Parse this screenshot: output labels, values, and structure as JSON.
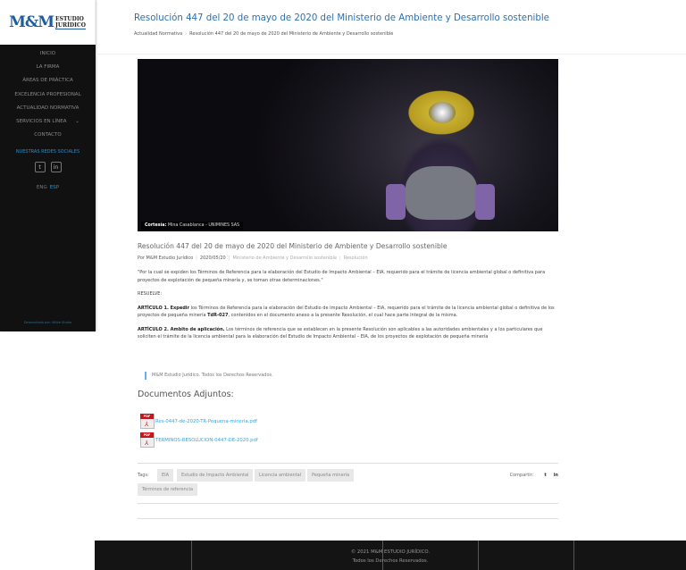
{
  "logo": {
    "mark": "M&M",
    "line1": "ESTUDIO",
    "line2": "JURÍDICO"
  },
  "nav": [
    "INICIO",
    "LA FIRMA",
    "ÁREAS DE PRÁCTICA",
    "EXCELENCIA PROFESIONAL",
    "ACTUALIDAD NORMATIVA",
    "SERVICIOS EN LÍNEA",
    "CONTACTO"
  ],
  "social": {
    "title": "NUESTRAS REDES SOCIALES",
    "twitter": "t",
    "linkedin": "in"
  },
  "lang": {
    "eng": "ENG",
    "esp": "ESP"
  },
  "developer": "Desarrollado por: Wiibe Studio",
  "header": {
    "title": "Resolución 447 del 20 de mayo de 2020 del Ministerio de Ambiente y Desarrollo sostenible",
    "breadcrumb": [
      "Actualidad Normativa",
      "Resolución 447 del 20 de mayo de 2020 del Ministerio de Ambiente y Desarrollo sostenible"
    ]
  },
  "photo": {
    "credit_label": "Cortesía:",
    "credit": "Mina Casablanca - UNIMINES SAS"
  },
  "article": {
    "title": "Resolución 447 del 20 de mayo de 2020 del Ministerio de Ambiente y Desarrollo sostenible",
    "author": "Por M&M Estudio Jurídico",
    "date": "2020/05/20",
    "categories": [
      "Ministerio de Ambiente y Desarrollo sostenible",
      "Resolución"
    ],
    "intro": "\"Por la cual se expiden los Términos de Referencia para la elaboración del Estudio de Impacto Ambiental – EIA, requerido para el trámite de licencia ambiental global o definitiva para proyectos de explotación de pequeña minería y, se toman otras determinaciones.\"",
    "resuelve": "RESUELVE:",
    "art1_head": "ARTÍCULO 1. Expedir",
    "art1_a": " los Términos de Referencia para la elaboración del Estudio de Impacto Ambiental – EIA, requerido para el trámite de la licencia ambiental global o definitiva de los proyectos de pequeña minería ",
    "art1_code": "TdR-027",
    "art1_b": ", contenidos en el documento anexo a la presente Resolución, el cual hace parte integral de la misma.",
    "art2_head": "ARTÍCULO 2. Ambito de aplicación.",
    "art2": " Los términos de referencia que se establecen en la presente Resolución son aplicables a las autoridades ambientales y a los particulares que soliciten el trámite de la licencia ambiental para la elaboración del Estudio de Impacto Ambiental – EIA, de los proyectos de explotación de pequeña minería",
    "quote": "M&M Estudio Jurídico. Todos los Derechos Reservados."
  },
  "docs": {
    "title": "Documentos Adjuntos:",
    "pdf_badge": "PDF",
    "files": [
      "Res-0447-de-2020-TR-Pequena-mineria.pdf",
      "TERMINOS-RESOLUCION-0447-DE-2020.pdf"
    ]
  },
  "tags": {
    "label": "Tags:",
    "items": [
      "EIA",
      "Estudio de Impacto Ambiental",
      "Licencia ambiental",
      "Pequeña minería",
      "Términos de referencia"
    ]
  },
  "share": {
    "label": "Compartir:",
    "twitter": "t",
    "linkedin": "in"
  },
  "footer": {
    "line1": "© 2021 M&M ESTUDIO JURÍDICO.",
    "line2": "Todos los Derechos Reservados."
  }
}
